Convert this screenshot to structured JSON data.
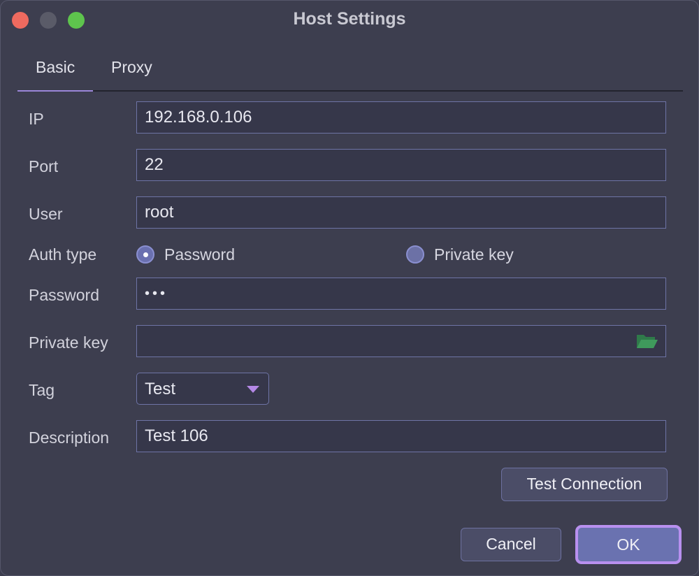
{
  "window": {
    "title": "Host Settings"
  },
  "tabs": [
    {
      "label": "Basic",
      "active": true
    },
    {
      "label": "Proxy",
      "active": false
    }
  ],
  "form": {
    "ip": {
      "label": "IP",
      "value": "192.168.0.106"
    },
    "port": {
      "label": "Port",
      "value": "22"
    },
    "user": {
      "label": "User",
      "value": "root"
    },
    "auth_type": {
      "label": "Auth type",
      "options": [
        {
          "label": "Password",
          "selected": true
        },
        {
          "label": "Private key",
          "selected": false
        }
      ]
    },
    "password": {
      "label": "Password",
      "value": "•••"
    },
    "private_key": {
      "label": "Private key",
      "value": "",
      "icon": "folder-open-icon"
    },
    "tag": {
      "label": "Tag",
      "value": "Test"
    },
    "description": {
      "label": "Description",
      "value": "Test 106"
    }
  },
  "buttons": {
    "test_connection": "Test Connection",
    "cancel": "Cancel",
    "ok": "OK"
  },
  "colors": {
    "accent": "#b890ef",
    "background": "#3d3e4f",
    "field_border": "#6e74a6",
    "folder_icon": "#3f8f5a"
  }
}
